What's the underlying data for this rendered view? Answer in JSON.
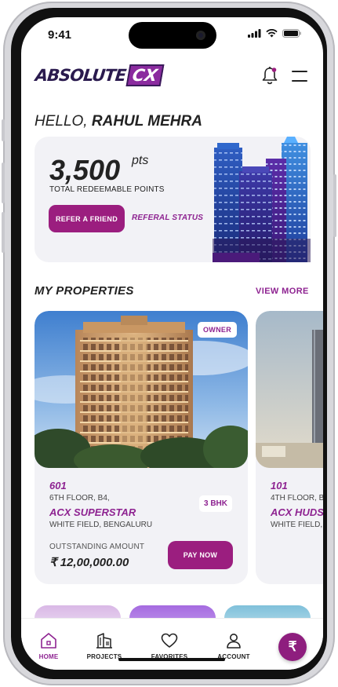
{
  "status_bar": {
    "time": "9:41"
  },
  "brand": {
    "name": "ABSOLUTE",
    "suffix": "CX"
  },
  "header": {
    "bell_icon": "bell-icon",
    "menu_icon": "hamburger-menu-icon"
  },
  "greeting": {
    "prefix": "HELLO,",
    "name": "RAHUL MEHRA"
  },
  "points": {
    "value": "3,500",
    "unit": "pts",
    "label": "TOTAL REDEEMABLE POINTS",
    "refer_button": "REFER A FRIEND",
    "status_link": "REFERAL STATUS"
  },
  "properties": {
    "title": "MY PROPERTIES",
    "view_more": "VIEW MORE",
    "items": [
      {
        "badge": "OWNER",
        "unit": "601",
        "floor": "6TH FLOOR, B4,",
        "name": "ACX SUPERSTAR",
        "location": "WHITE FIELD, BENGALURU",
        "type": "3 BHK",
        "amount_label": "OUTSTANDING AMOUNT",
        "amount": "₹ 12,00,000.00",
        "pay_button": "PAY NOW"
      },
      {
        "unit": "101",
        "floor": "4TH FLOOR, B",
        "name": "ACX HUDS",
        "location": "WHITE FIELD, B"
      }
    ]
  },
  "tabs": [
    {
      "label": "HOME",
      "icon": "home-icon",
      "active": true
    },
    {
      "label": "PROJECTS",
      "icon": "building-icon"
    },
    {
      "label": "FAVORITES",
      "icon": "heart-icon"
    },
    {
      "label": "ACCOUNT",
      "icon": "user-icon"
    }
  ],
  "fab": {
    "symbol": "₹",
    "icon": "rupee-icon"
  },
  "colors": {
    "brand": "#9b1e7f",
    "accent": "#8e2391",
    "card_bg": "#f2f2f6"
  }
}
